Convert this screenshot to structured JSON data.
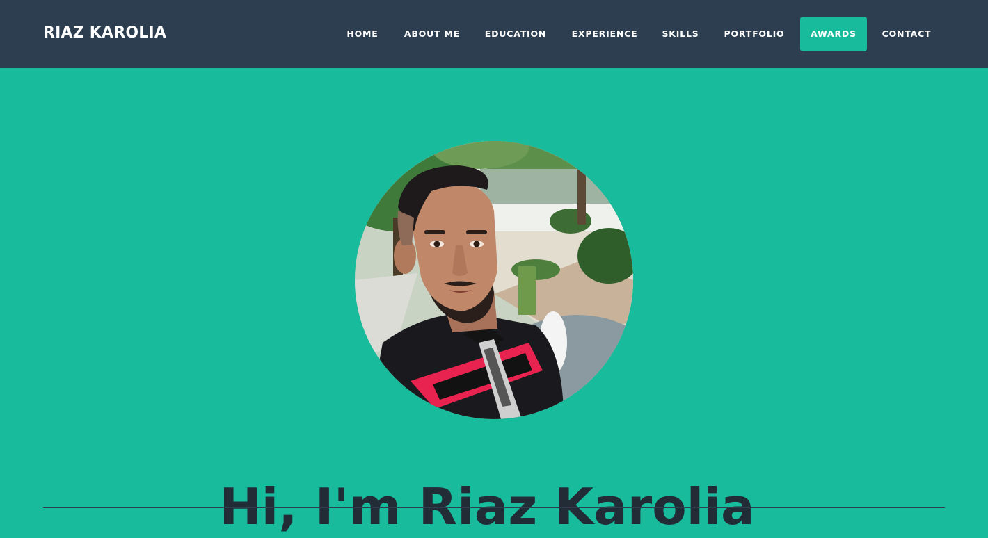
{
  "nav": {
    "brand": "RIAZ KAROLIA",
    "items": [
      {
        "label": "HOME",
        "active": false
      },
      {
        "label": "ABOUT ME",
        "active": false
      },
      {
        "label": "EDUCATION",
        "active": false
      },
      {
        "label": "EXPERIENCE",
        "active": false
      },
      {
        "label": "SKILLS",
        "active": false
      },
      {
        "label": "PORTFOLIO",
        "active": false
      },
      {
        "label": "AWARDS",
        "active": true
      },
      {
        "label": "CONTACT",
        "active": false
      }
    ]
  },
  "hero": {
    "title": "Hi, I'm Riaz Karolia"
  },
  "colors": {
    "navbar": "#2c3e50",
    "accent": "#18bc9c",
    "heading": "#222c37",
    "nav_text": "#ffffff"
  }
}
